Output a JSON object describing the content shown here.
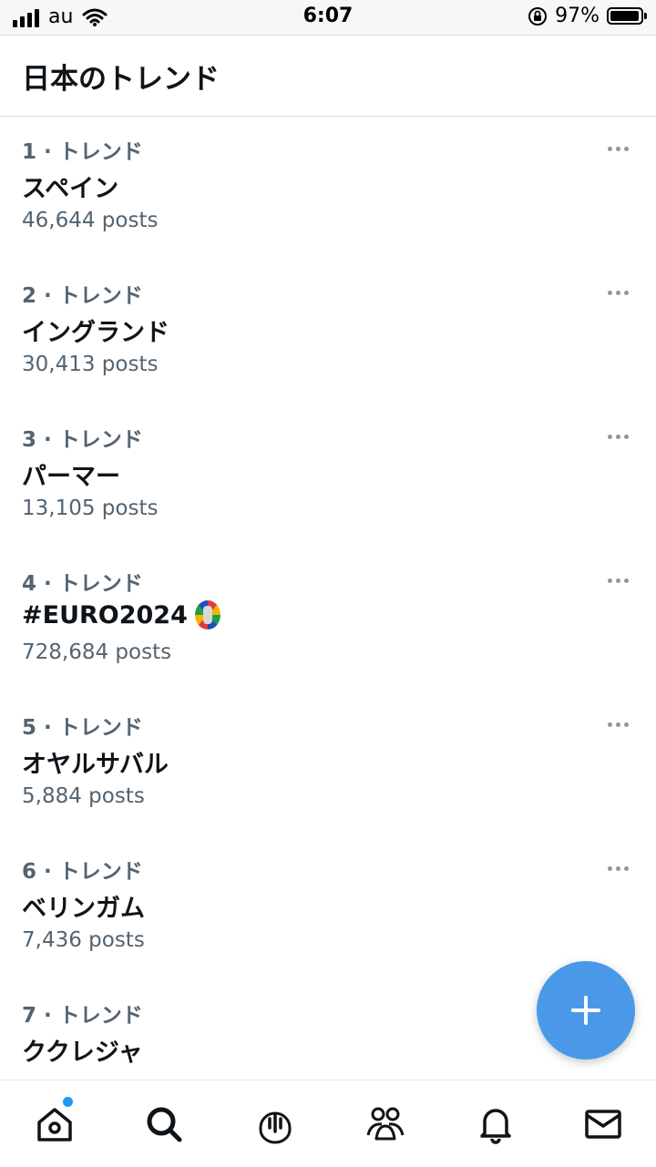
{
  "status_bar": {
    "carrier": "au",
    "time": "6:07",
    "battery_percent": "97%",
    "battery_level": 0.97
  },
  "header": {
    "title": "日本のトレンド"
  },
  "trends": [
    {
      "meta": "1 · トレンド",
      "name": "スペイン",
      "count": "46,644 posts"
    },
    {
      "meta": "2 · トレンド",
      "name": "イングランド",
      "count": "30,413 posts"
    },
    {
      "meta": "3 · トレンド",
      "name": "パーマー",
      "count": "13,105 posts"
    },
    {
      "meta": "4 · トレンド",
      "name": "#EURO2024",
      "count": "728,684 posts",
      "has_emblem": true
    },
    {
      "meta": "5 · トレンド",
      "name": "オヤルサバル",
      "count": "5,884 posts"
    },
    {
      "meta": "6 · トレンド",
      "name": "ベリンガム",
      "count": "7,436 posts"
    },
    {
      "meta": "7 · トレンド",
      "name": "ククレジャ",
      "count": ""
    }
  ],
  "fab": {
    "icon": "plus-icon"
  },
  "bottom_nav": [
    {
      "name": "home",
      "icon": "home-icon",
      "has_notification_dot": true
    },
    {
      "name": "search",
      "icon": "search-icon"
    },
    {
      "name": "spaces",
      "icon": "spaces-icon"
    },
    {
      "name": "communities",
      "icon": "communities-icon"
    },
    {
      "name": "notifications",
      "icon": "bell-icon"
    },
    {
      "name": "messages",
      "icon": "mail-icon"
    }
  ],
  "colors": {
    "accent": "#4a99e9",
    "secondary_text": "#536471",
    "primary_text": "#0f1419"
  }
}
